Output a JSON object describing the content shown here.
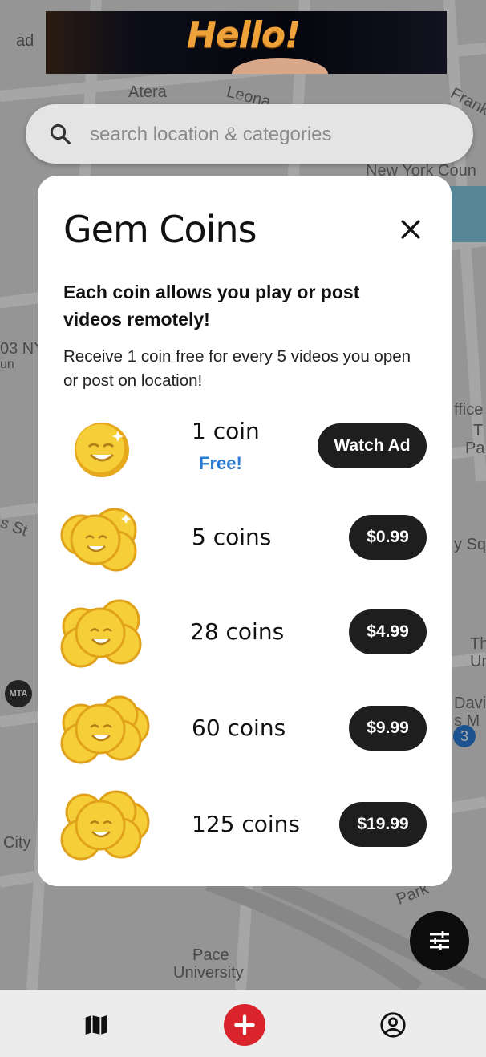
{
  "ad": {
    "label": "ad",
    "banner_text": "Hello!"
  },
  "search": {
    "placeholder": "search location & categories"
  },
  "map_labels": [
    "Atera",
    "Leona",
    "Frank",
    "New York Coun",
    "03 NY",
    "un",
    "ffice",
    "T",
    "Pa",
    "s St",
    "y Squ",
    "Th",
    "Un",
    "Davic",
    "s M",
    "City",
    "Park",
    "Pace",
    "University",
    "3",
    "MTA"
  ],
  "modal": {
    "title": "Gem Coins",
    "bold_description": "Each coin allows you play or post videos remotely!",
    "description": "Receive 1 coin free for every 5 videos you open or post on location!",
    "packages": [
      {
        "count": "1 coin",
        "sub": "Free!",
        "button": "Watch Ad",
        "icon": "single-coin-icon"
      },
      {
        "count": "5 coins",
        "button": "$0.99",
        "icon": "coin-stack-icon"
      },
      {
        "count": "28 coins",
        "button": "$4.99",
        "icon": "coin-pile-icon"
      },
      {
        "count": "60 coins",
        "button": "$9.99",
        "icon": "coin-pile-icon"
      },
      {
        "count": "125 coins",
        "button": "$19.99",
        "icon": "coin-pile-icon"
      }
    ]
  },
  "colors": {
    "accent_blue": "#2a7bd1",
    "button_dark": "#1e1e1e",
    "add_red": "#d8242a",
    "coin_gold": "#f2c230"
  },
  "nav": {
    "items": [
      "map-icon",
      "add-icon",
      "profile-icon"
    ]
  }
}
